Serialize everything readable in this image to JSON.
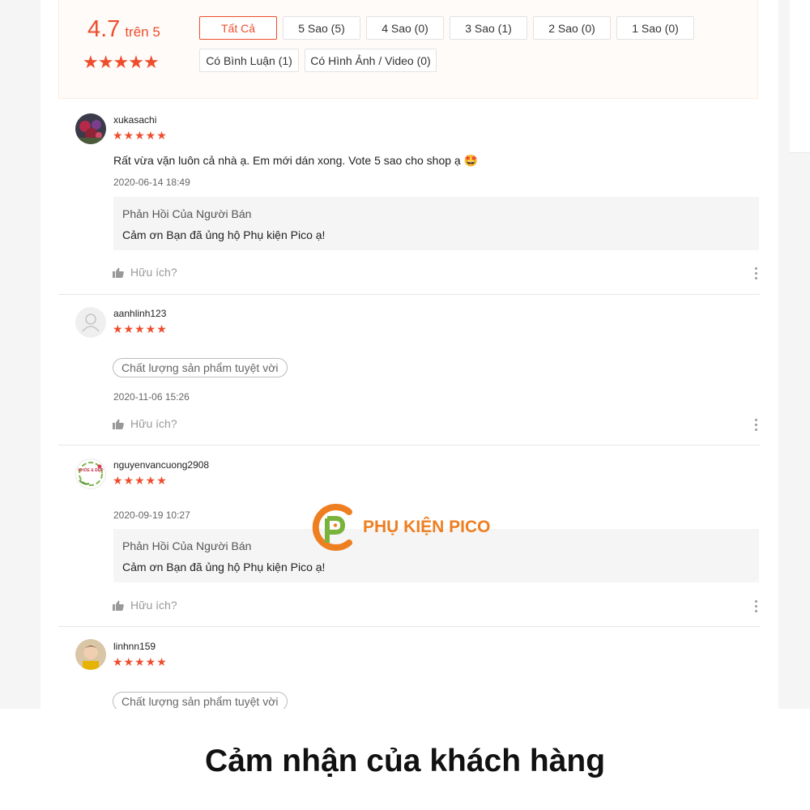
{
  "summary": {
    "score": "4.7",
    "out_of": "trên 5",
    "stars": "★★★★★"
  },
  "filters": [
    {
      "label": "Tất Cả",
      "active": true
    },
    {
      "label": "5 Sao (5)"
    },
    {
      "label": "4 Sao (0)"
    },
    {
      "label": "3 Sao (1)"
    },
    {
      "label": "2 Sao (0)"
    },
    {
      "label": "1 Sao (0)"
    },
    {
      "label": "Có Bình Luận (1)"
    },
    {
      "label": "Có Hình Ảnh / Video (0)"
    }
  ],
  "reviews": [
    {
      "username": "xukasachi",
      "stars": "★★★★★",
      "comment": "Rất vừa vặn luôn cả nhà ạ. Em mới dán xong. Vote 5 sao cho shop ạ 🤩",
      "date": "2020-06-14 18:49",
      "reply_title": "Phản Hồi Của Người Bán",
      "reply_text": "Cảm ơn Bạn đã ủng hộ Phụ kiện Pico ạ!",
      "helpful": "Hữu ích?"
    },
    {
      "username": "aanhlinh123",
      "stars": "★★★★★",
      "tag": "Chất lượng sản phẩm tuyệt vời",
      "date": "2020-11-06 15:26",
      "helpful": "Hữu ích?"
    },
    {
      "username": "nguyenvancuong2908",
      "avatar_text": "KHỎE & ĐẸP",
      "stars": "★★★★★",
      "date": "2020-09-19 10:27",
      "reply_title": "Phản Hồi Của Người Bán",
      "reply_text": "Cảm ơn Bạn đã ủng hộ Phụ kiện Pico ạ!",
      "helpful": "Hữu ích?"
    },
    {
      "username": "linhnn159",
      "stars": "★★★★★",
      "tag": "Chất lượng sản phẩm tuyệt vời"
    }
  ],
  "watermark": {
    "text": "PHỤ KIỆN PICO",
    "color": "#ee7f21"
  },
  "caption": "Cảm nhận của khách hàng",
  "colors": {
    "accent": "#ee4d2d",
    "reply_bg": "#f5f5f5",
    "overview_bg": "#fffbf8"
  },
  "icons": [
    "star-icon",
    "thumbs-up-icon",
    "more-vertical-icon",
    "default-avatar-icon"
  ]
}
